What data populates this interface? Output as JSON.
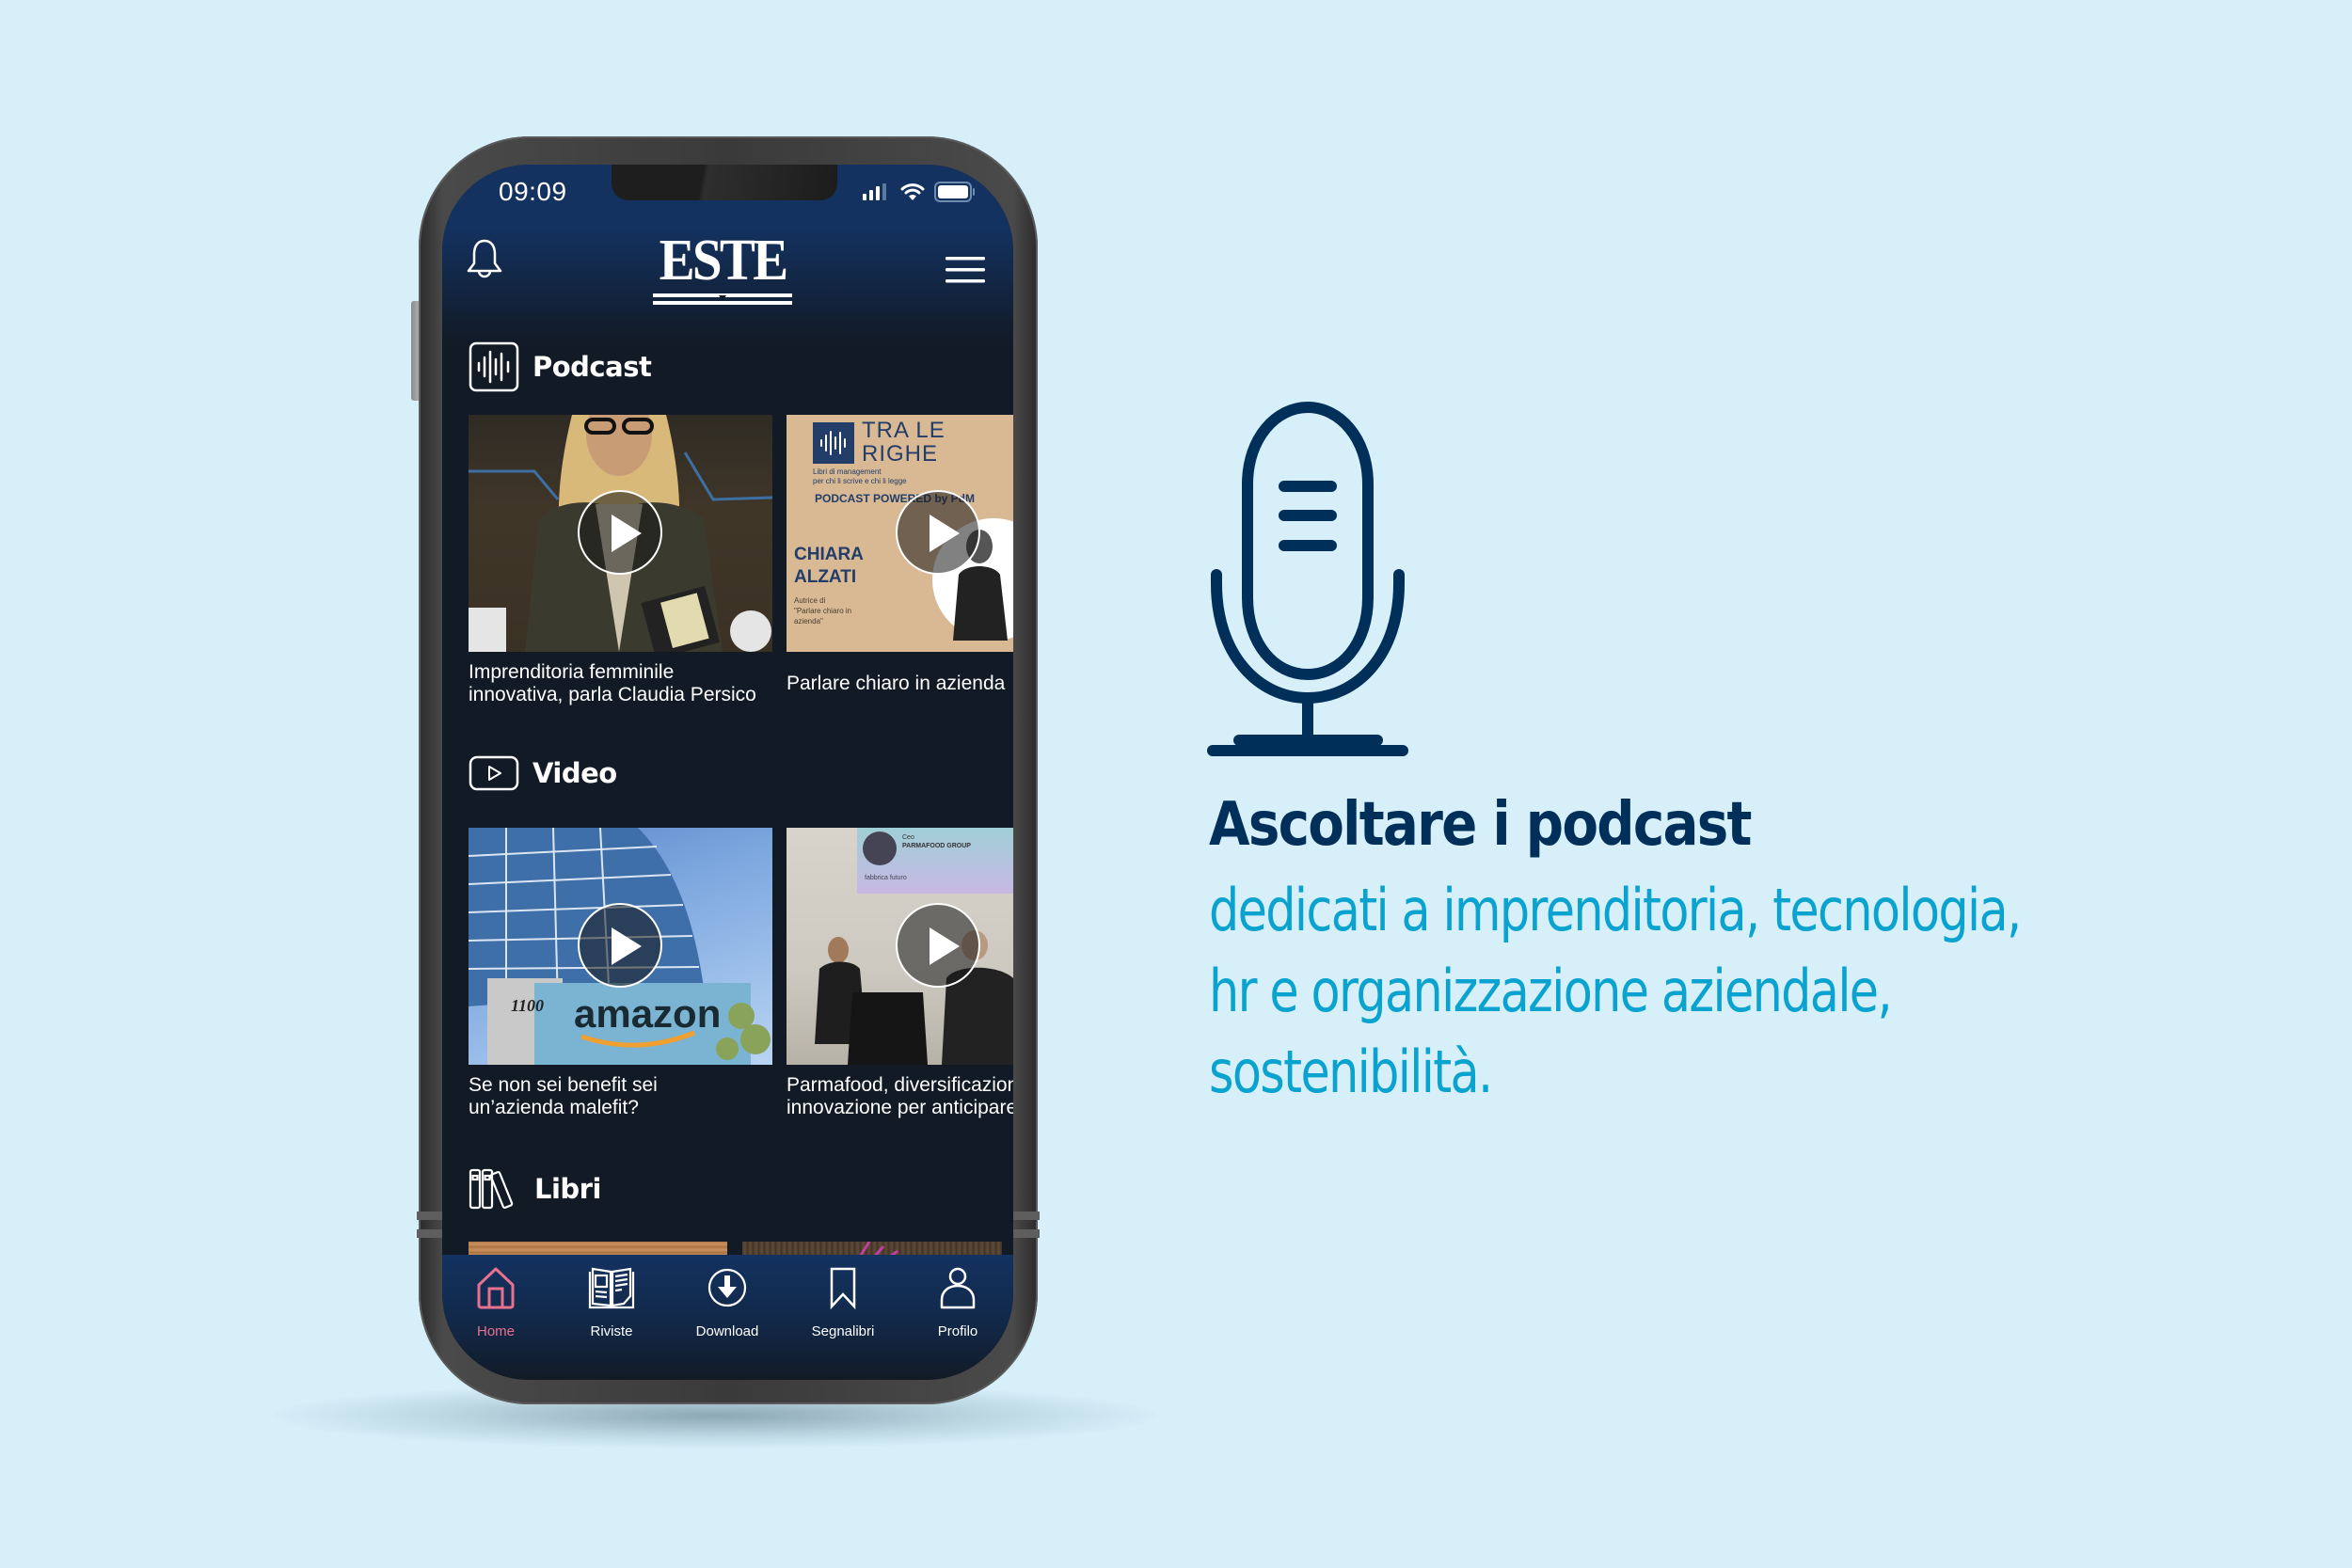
{
  "status_bar": {
    "time": "09:09"
  },
  "app_header": {
    "logo_text": "ESTE",
    "notifications_icon": "bell-icon",
    "menu_icon": "hamburger-menu-icon"
  },
  "sections": {
    "podcast": {
      "title": "Podcast",
      "icon": "audio-waveform-icon",
      "items": [
        {
          "title_line1": "Imprenditoria femminile",
          "title_line2": "innovativa, parla Claudia Persico",
          "thumb_alt": "Claudia Persico holding an award"
        },
        {
          "title_line1": "Parlare chiaro in azienda",
          "thumb": {
            "brand_line1": "TRA LE",
            "brand_line2": "RIGHE",
            "tagline1": "Libri di management",
            "tagline2": "per chi li scrive e chi li legge",
            "powered": "PODCAST POWERED by PdM",
            "guest_first": "CHIARA",
            "guest_last": "ALZATI",
            "guest_desc1": "Autrice di",
            "guest_desc2": "\"Parlare chiaro in",
            "guest_desc3": "azienda\""
          }
        }
      ]
    },
    "video": {
      "title": "Video",
      "icon": "play-square-icon",
      "items": [
        {
          "title_line1": "Se non sei benefit sei",
          "title_line2": "un’azienda malefit?",
          "thumb": {
            "sign_number": "1100",
            "sign_brand": "amazon"
          }
        },
        {
          "title_line1": "Parmafood, diversificazione e",
          "title_line2": "innovazione per anticipare il",
          "thumb": {
            "screen_label1": "Ceo",
            "screen_label2": "PARMAFOOD GROUP",
            "screen_logo": "fabbrica futuro"
          }
        }
      ]
    },
    "libri": {
      "title": "Libri",
      "icon": "books-icon"
    }
  },
  "tab_bar": {
    "items": [
      {
        "label": "Home",
        "icon": "home-icon",
        "active": true
      },
      {
        "label": "Riviste",
        "icon": "magazine-icon",
        "active": false
      },
      {
        "label": "Download",
        "icon": "download-circle-icon",
        "active": false
      },
      {
        "label": "Segnalibri",
        "icon": "bookmark-icon",
        "active": false
      },
      {
        "label": "Profilo",
        "icon": "user-icon",
        "active": false
      }
    ],
    "active_color": "#e8718f"
  },
  "promo": {
    "icon": "microphone-icon",
    "headline": "Ascoltare i podcast",
    "body_lines": [
      "dedicati a imprenditoria, tecnologia,",
      "hr e organizzazione aziendale,",
      "sostenibilità."
    ],
    "colors": {
      "headline": "#00305a",
      "body": "#0aa3cf",
      "background": "#d6eff9"
    }
  }
}
